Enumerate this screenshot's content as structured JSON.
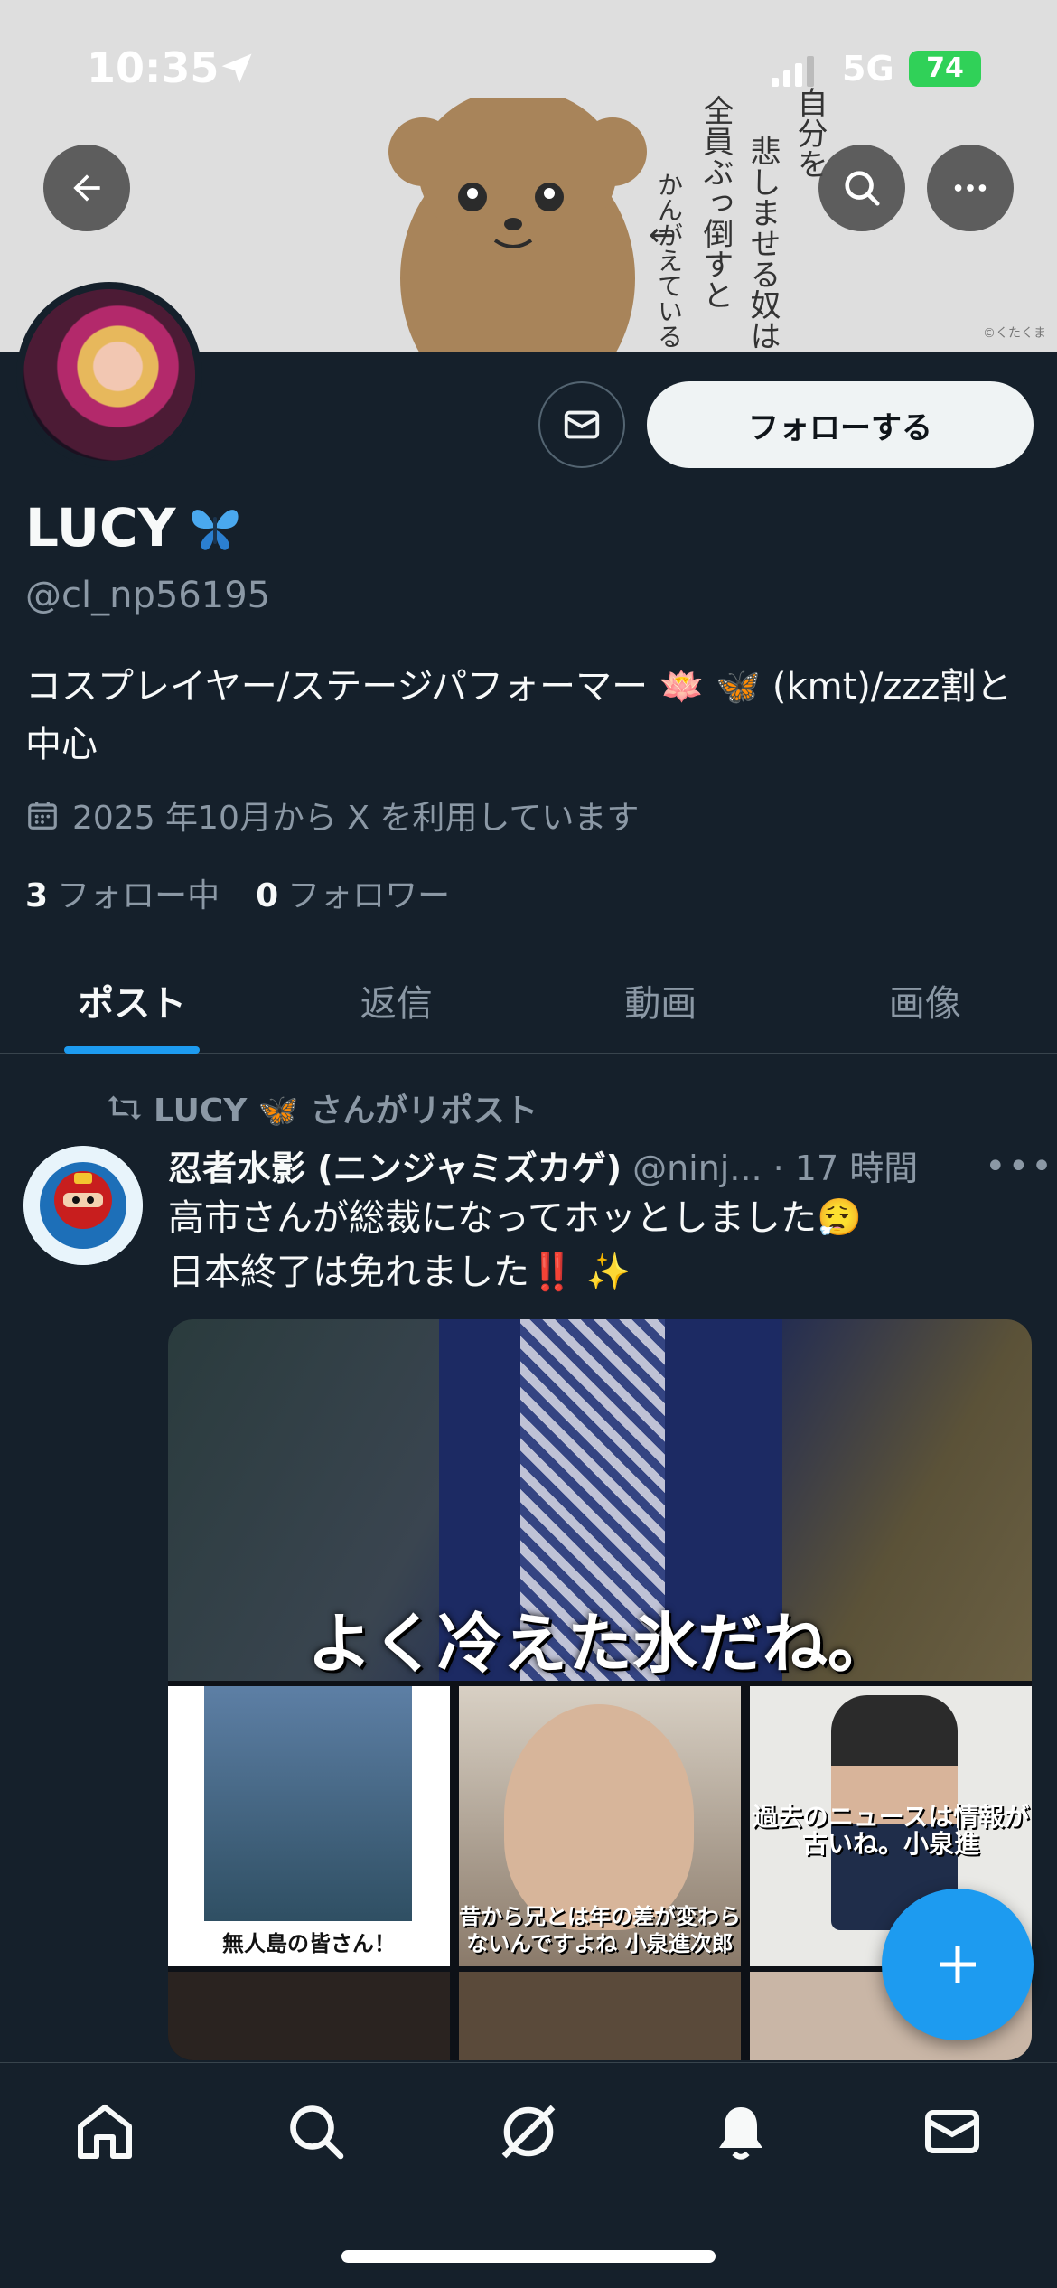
{
  "status_bar": {
    "time": "10:35",
    "network": "5G",
    "battery": "74"
  },
  "banner": {
    "vertical_lines": [
      "自分を",
      "悲しませる奴は",
      "全員ぶっ倒すと",
      "かんがえている"
    ],
    "credit": "©くたくま"
  },
  "profile": {
    "display_name": "LUCY",
    "handle": "@cl_np56195",
    "bio": "コスプレイヤー/ステージパフォーマー 🪷 🦋 (kmt)/zzz割と中心",
    "joined": "2025 年10月から X を利用しています",
    "following_count": "3",
    "following_label": "フォロー中",
    "followers_count": "0",
    "followers_label": "フォロワー",
    "follow_button": "フォローする"
  },
  "tabs": [
    {
      "label": "ポスト",
      "active": true
    },
    {
      "label": "返信",
      "active": false
    },
    {
      "label": "動画",
      "active": false
    },
    {
      "label": "画像",
      "active": false
    }
  ],
  "post": {
    "repost_label": "LUCY 🦋 さんがリポスト",
    "author_name": "忍者水影 (ニンジャミズカゲ)",
    "author_handle": "@ninj...",
    "time": "· 17 時間",
    "text_line1": "高市さんが総裁になってホッとしました😮‍💨",
    "text_line2": "日本終了は免れました‼️ ✨",
    "media": {
      "main_caption": "よく冷えた氷だね。",
      "tile1_caption": "無人島の皆さん！",
      "tile2_caption": "昔から兄とは年の差が変わらないんですよね 小泉進次郎",
      "tile3_caption": "過去のニュースは情報が古いね。小泉進"
    }
  },
  "colors": {
    "accent": "#1d9bf0",
    "background": "#15202b",
    "secondary_text": "#8b98a5"
  },
  "icons": [
    "back-arrow-icon",
    "search-icon",
    "more-icon",
    "mail-icon",
    "calendar-icon",
    "repost-icon",
    "home-icon",
    "explore-icon",
    "grok-icon",
    "notifications-icon",
    "messages-icon",
    "compose-plus-icon"
  ]
}
